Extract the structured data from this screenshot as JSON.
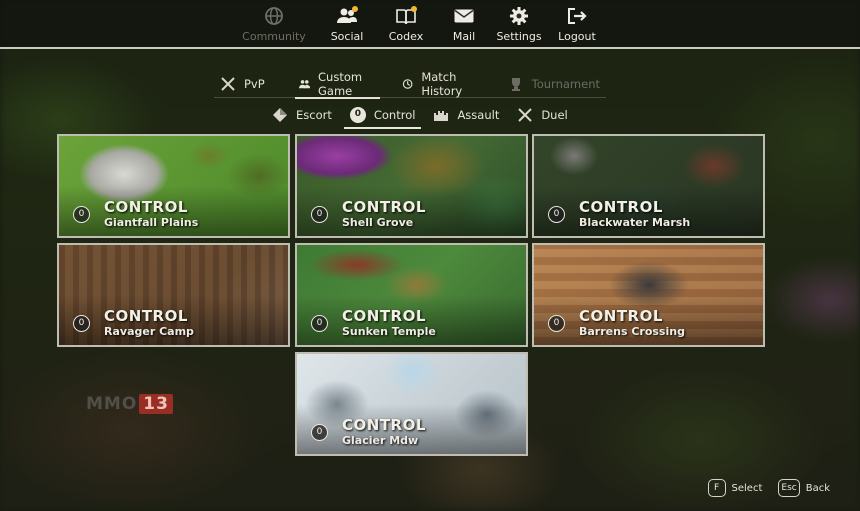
{
  "nav": {
    "items": [
      {
        "label": "Community",
        "icon": "globe-icon",
        "enabled": false
      },
      {
        "label": "Social",
        "icon": "friends-icon",
        "enabled": true,
        "notification": true
      },
      {
        "label": "Codex",
        "icon": "book-icon",
        "enabled": true,
        "notification": true
      },
      {
        "label": "Mail",
        "icon": "mail-icon",
        "enabled": true
      },
      {
        "label": "Settings",
        "icon": "gear-icon",
        "enabled": true
      },
      {
        "label": "Logout",
        "icon": "logout-icon",
        "enabled": true
      }
    ]
  },
  "mode_tabs": [
    {
      "label": "PvP",
      "icon": "crossed-swords-icon",
      "active": false
    },
    {
      "label": "Custom Game",
      "icon": "group-icon",
      "active": true
    },
    {
      "label": "Match History",
      "icon": "history-icon",
      "active": false
    },
    {
      "label": "Tournament",
      "icon": "trophy-icon",
      "active": false,
      "enabled": false
    }
  ],
  "type_tabs": [
    {
      "label": "Escort",
      "icon": "diamond-icon",
      "active": false
    },
    {
      "label": "Control",
      "icon": "zero-badge-icon",
      "active": true
    },
    {
      "label": "Assault",
      "icon": "fortress-icon",
      "active": false
    },
    {
      "label": "Duel",
      "icon": "crossed-swords-icon",
      "active": false
    }
  ],
  "maps": [
    {
      "mode": "CONTROL",
      "name": "Giantfall Plains",
      "badge": "0"
    },
    {
      "mode": "CONTROL",
      "name": "Shell Grove",
      "badge": "0"
    },
    {
      "mode": "CONTROL",
      "name": "Blackwater Marsh",
      "badge": "0"
    },
    {
      "mode": "CONTROL",
      "name": "Ravager Camp",
      "badge": "0"
    },
    {
      "mode": "CONTROL",
      "name": "Sunken Temple",
      "badge": "0"
    },
    {
      "mode": "CONTROL",
      "name": "Barrens Crossing",
      "badge": "0"
    },
    {
      "mode": "CONTROL",
      "name": "Glacier Mdw",
      "badge": "0"
    }
  ],
  "watermark": {
    "text": "MMO",
    "number": "13"
  },
  "hints": [
    {
      "key": "F",
      "label": "Select"
    },
    {
      "key": "Esc",
      "label": "Back"
    }
  ]
}
